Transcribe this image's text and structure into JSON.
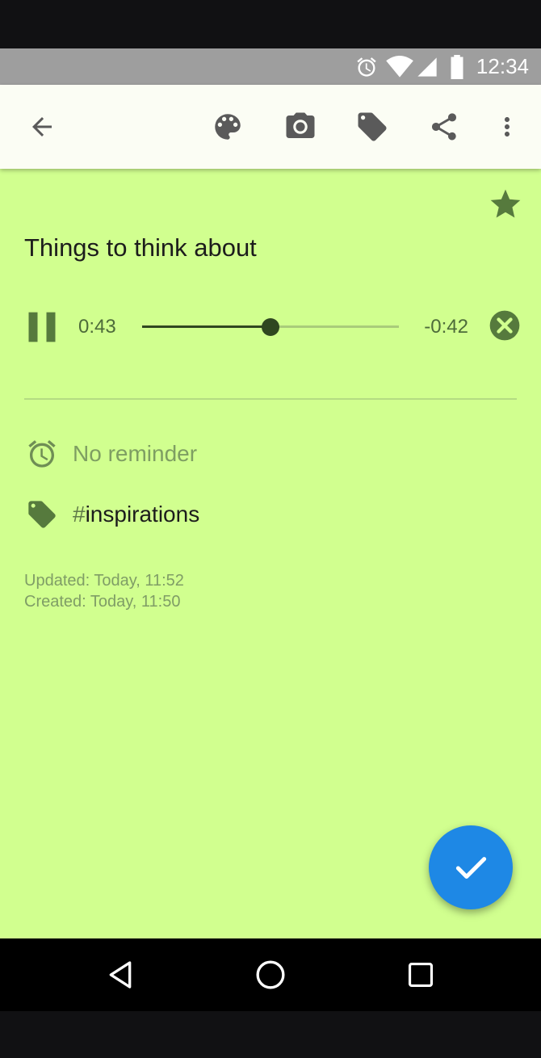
{
  "status_bar": {
    "time": "12:34",
    "icons": [
      "alarm-icon",
      "wifi-icon",
      "signal-icon",
      "battery-icon"
    ]
  },
  "toolbar": {
    "icons": [
      "back-arrow-icon",
      "palette-icon",
      "camera-icon",
      "tag-icon",
      "share-icon",
      "more-vert-icon"
    ]
  },
  "note": {
    "title": "Things to think about",
    "starred": true,
    "background_color": "#d1ff8f",
    "audio": {
      "current_time": "0:43",
      "remaining_time": "-0:42",
      "progress": 0.5
    },
    "reminder": "No reminder",
    "tag": {
      "hash": "#",
      "name": "inspirations"
    },
    "updated": "Updated: Today, 11:52",
    "created": "Created: Today, 11:50"
  },
  "fab": {
    "icon": "check-icon",
    "color": "#1e88e5"
  },
  "nav_bar": {
    "icons": [
      "back-triangle-icon",
      "home-circle-icon",
      "recents-square-icon"
    ]
  }
}
